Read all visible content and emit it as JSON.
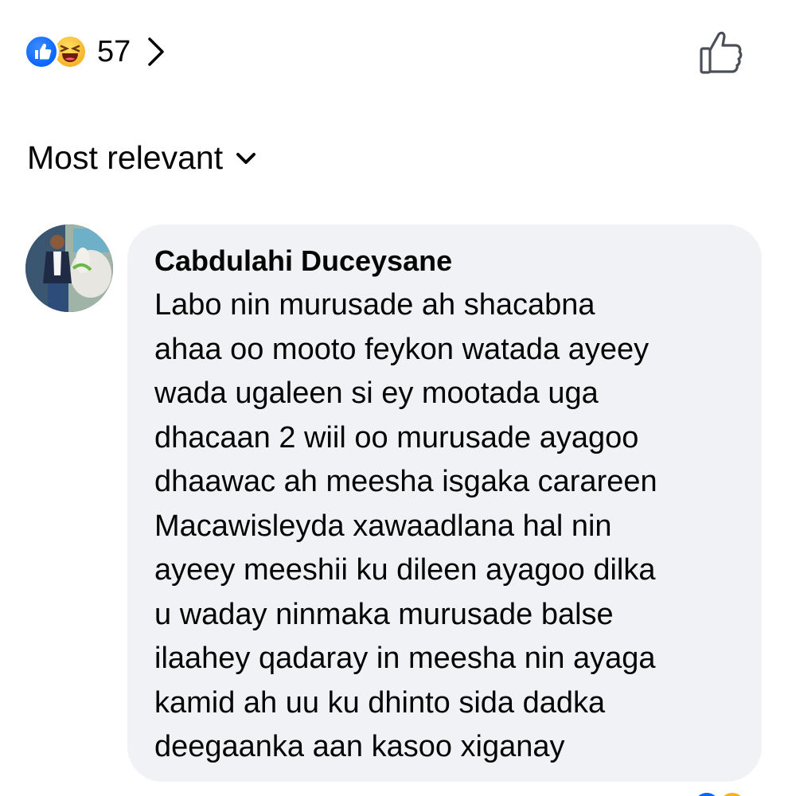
{
  "reactions": {
    "types": [
      "like-icon",
      "haha-icon"
    ],
    "count": "57",
    "colors": {
      "like": "#0866ff",
      "haha": "#f7b125"
    }
  },
  "sort": {
    "label": "Most relevant"
  },
  "comment": {
    "author": "Cabdulahi Duceysane",
    "lines": [
      "Labo nin murusade ah shacabna",
      "ahaa oo mooto feykon watada ayeey",
      "wada ugaleen si ey mootada uga",
      "dhacaan 2 wiil oo murusade ayagoo",
      "dhaawac ah meesha isgaka carareen",
      "Macawisleyda xawaadlana hal nin",
      "ayeey meeshii ku dileen ayagoo dilka",
      "u waday ninmaka murusade balse",
      "ilaahey qadaray in meesha nin ayaga",
      "kamid ah uu ku dhinto sida dadka",
      "deegaanka aan kasoo xiganay"
    ],
    "bubble_color": "#f0f2f5"
  }
}
